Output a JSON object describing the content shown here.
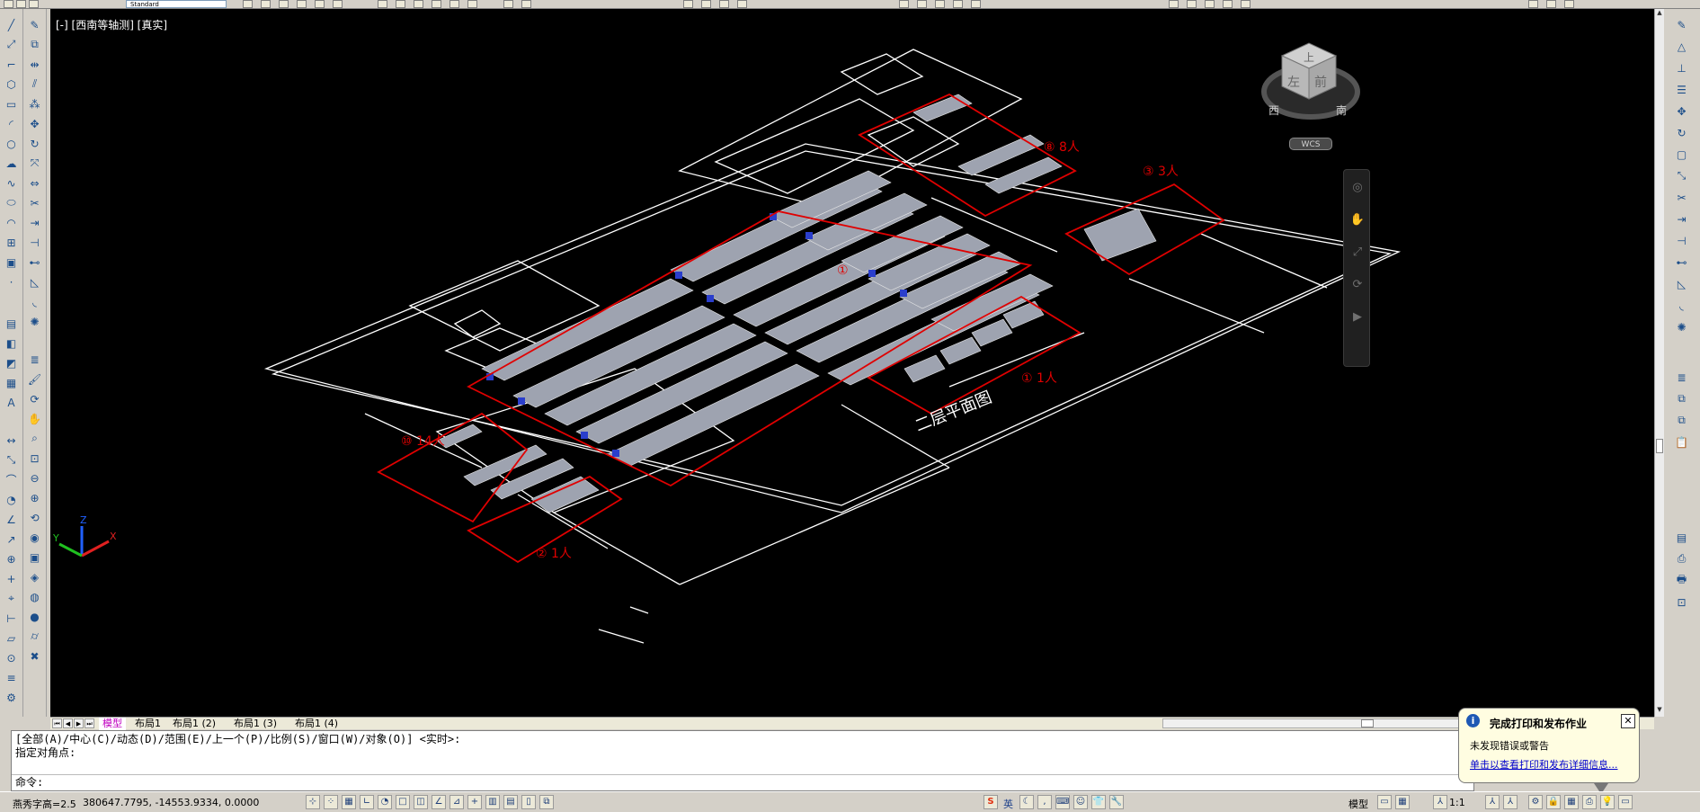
{
  "toolbar": {
    "text_style": "Standard"
  },
  "viewport": {
    "label": "[-] [西南等轴测] [真实]",
    "floor_title": "二层平面图",
    "zone_labels": [
      "⑧ 8人",
      "③ 3人",
      "①",
      "① 1人",
      "⑩ 14人",
      "② 1人"
    ],
    "ucs": {
      "x": "X",
      "y": "Y",
      "z": "Z"
    }
  },
  "viewcube": {
    "top": "上",
    "left": "左",
    "front": "前",
    "west": "西",
    "south": "南",
    "wcs": "WCS"
  },
  "tabs": [
    {
      "label": "模型",
      "active": true
    },
    {
      "label": "布局1",
      "active": false
    },
    {
      "label": "布局1 (2)",
      "active": false
    },
    {
      "label": "布局1 (3)",
      "active": false
    },
    {
      "label": "布局1 (4)",
      "active": false
    }
  ],
  "command": {
    "history_line1": "[全部(A)/中心(C)/动态(D)/范围(E)/上一个(P)/比例(S)/窗口(W)/对象(O)] <实时>:",
    "history_line2": "指定对角点:",
    "prompt": "命令:"
  },
  "status": {
    "text_height": "燕秀字高=2.5",
    "coordinates": "380647.7795, -14553.9334, 0.0000",
    "ime": "英",
    "model": "模型",
    "scale": "1:1"
  },
  "notification": {
    "title": "完成打印和发布作业",
    "message": "未发现错误或警告",
    "link": "单击以查看打印和发布详细信息..."
  },
  "icons": {
    "info": "i",
    "close": "✕"
  },
  "colors": {
    "background": "#000000",
    "walls": "#ffffff",
    "zone_outline": "#e00000",
    "accent_tab": "#c000c0"
  }
}
